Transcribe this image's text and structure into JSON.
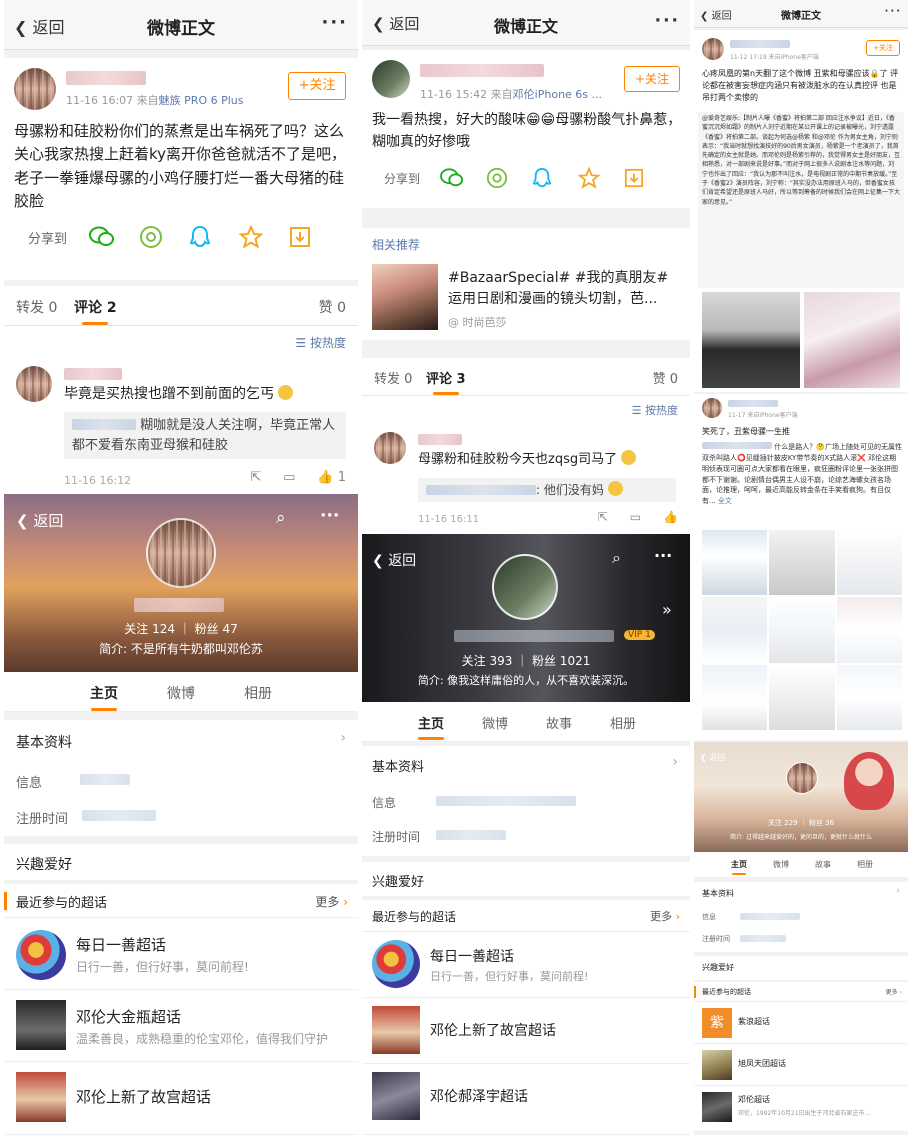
{
  "nav": {
    "back": "返回",
    "title": "微博正文",
    "more": "···"
  },
  "p1": {
    "meta_time": "11-16 16:07",
    "meta_from": "来自",
    "meta_src": "魅族 PRO 6 Plus",
    "follow": "+关注",
    "post": "母骡粉和硅胶粉你们的蒸煮是出车祸死了吗？这么关心我家热搜上赶着ky离开你爸爸就活不了是吧，老子一拳锤爆母骡的小鸡仔腰打烂一番大母猪的硅胶脸",
    "share": "分享到",
    "tab_repost": "转发 0",
    "tab_comment": "评论 2",
    "tab_like": "赞 0",
    "sort": "按热度",
    "comment": "毕竟是买热搜也蹭不到前面的乞丐",
    "reply": "糊咖就是没人关注啊，毕竟正常人都不爱看东南亚母猴和硅胶",
    "ctime": "11-16 16:12",
    "clike": "1",
    "profile": {
      "back": "返回",
      "stats": "关注 124  ｜  粉丝 47",
      "bio": "简介: 不是所有牛奶都叫邓伦苏",
      "tabs": [
        "主页",
        "微博",
        "相册"
      ],
      "basic": "基本资料",
      "info": "信息",
      "reg": "注册时间",
      "hobby": "兴趣爱好",
      "recent": "最近参与的超话",
      "more": "更多",
      "topics": [
        {
          "name": "每日一善超话",
          "desc": "日行一善，但行好事，莫问前程!"
        },
        {
          "name": "邓伦大金瓶超话",
          "desc": "温柔善良，成熟稳重的伦宝邓伦，值得我们守护"
        },
        {
          "name": "邓伦上新了故宫超话",
          "desc": ""
        }
      ]
    }
  },
  "p2": {
    "meta_time": "11-16 15:42",
    "meta_from": "来自",
    "meta_src": "邓伦iPhone 6s ...",
    "follow": "+关注",
    "post": "我一看热搜，好大的酸味😁😁母骡粉酸气扑鼻惹，糊咖真的好惨哦",
    "share": "分享到",
    "rel": "相关推荐",
    "rel_title": "#BazaarSpecial# #我的真朋友# 运用日剧和漫画的镜头切割，芭...",
    "rel_src": "@ 时尚芭莎",
    "tab_repost": "转发 0",
    "tab_comment": "评论 3",
    "tab_like": "赞 0",
    "sort": "按热度",
    "comment": "母骡粉和硅胶粉今天也zqsg司马了",
    "reply": ": 他们没有妈",
    "ctime": "11-16 16:11",
    "profile": {
      "back": "返回",
      "stats": "关注 393  ｜  粉丝 1021",
      "bio": "简介: 像我这样庸俗的人，从不喜欢装深沉。",
      "vip": "VIP 1",
      "tabs": [
        "主页",
        "微博",
        "故事",
        "相册"
      ],
      "basic": "基本资料",
      "info": "信息",
      "reg": "注册时间",
      "hobby": "兴趣爱好",
      "recent": "最近参与的超话",
      "more": "更多",
      "topics": [
        {
          "name": "每日一善超话",
          "desc": "日行一善，但行好事，莫问前程!"
        },
        {
          "name": "邓伦上新了故宫超话",
          "desc": ""
        },
        {
          "name": "邓伦郝泽宇超话",
          "desc": ""
        }
      ]
    }
  },
  "p3": {
    "meta": "11-12 17:19  来自iPhone客户端",
    "follow": "+关注",
    "post": "心疼凤凰的第n天翻了这个微博 丑紫和母骡应该🔒了 评论都在被害妄想症内涵只有被泼脏水的在认真控评 也是吊打两个卖惨的",
    "repost": "@爱奇艺娱乐:【制片人曝《香蜜》将拍第二部 回应注水争议】近日，《香蜜沉沉烬如霜》的制片人刘宁近期在某公开课上的记录被曝光，刘宁透露《香蜜》将拍第二部。谈起为何选@杨紫 和@邓伦 作为男女主角，刘宁则表示：“我当时就想找演技好的90后男女演员，杨紫是一个老演员了，我首先确定的女主就是她。而邓伦则是杨紫引荐的，我觉得男女主是好朋友，互相熟悉，对一部剧来说是好事。”而对于网上很多人说剧本注水等问题，刘宁也作出了回应：“我认为那不叫注水，是电视剧正常的中期节奏放缓。”至于《香蜜2》演员阵容，刘宁称：“其实没办法用原班人马的，但香蜜女孩们肯定希望还是原班人马好，所以等到筹备的时候我们会在网上征集一下大家的意见。”",
    "c_meta": "11-17  来自iPhone客户端",
    "c_text": "笑死了，丑紫母骡一生推",
    "c2": "什么是路人？🤔广场上随处可见的无属性双杀叫路人⭕见缝插针披皮KY带节奏的X式路人滚❌ 邓伦这期明侦表现可圈可点大家都看在眼里，疯狂圈粉评论里一张张拼图都不下谢谢。论剧情台偶男主人设不崩，论综艺海螺女孩名场面，论推理，呵呵，最近高能反转金条在手笑看疯狗。有且仅有...",
    "c2_more": "全文",
    "profile": {
      "back": "返回",
      "stats": "关注 229 ｜ 粉丝 36",
      "bio": "简介: 过得越来越爱好的，更的旦的，更就什么就什么",
      "tabs": [
        "主页",
        "微博",
        "故事",
        "相册"
      ],
      "basic": "基本资料",
      "info": "信息",
      "reg": "注册时间",
      "hobby": "兴趣爱好",
      "recent": "最近参与的超话",
      "more": "更多",
      "topics": [
        {
          "name": "紫浪超话",
          "desc": ""
        },
        {
          "name": "旭凤天团超话",
          "desc": ""
        },
        {
          "name": "邓伦超话",
          "desc": "邓伦，1992年10月21日出生于河北省石家庄市..."
        }
      ],
      "purple_char": "紫"
    }
  },
  "colors": {
    "accent": "#ff8200",
    "link": "#5b7aa8",
    "text": "#222222",
    "bg": "#f2f2f2"
  }
}
